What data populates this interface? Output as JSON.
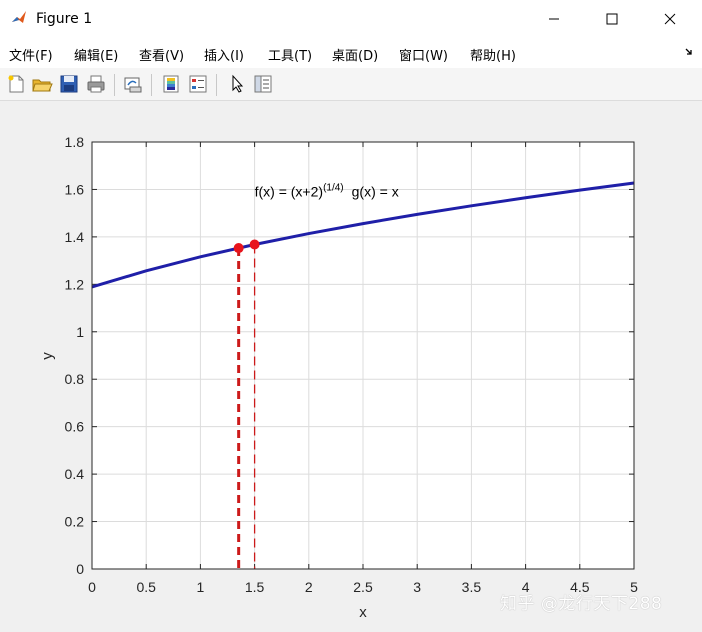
{
  "window": {
    "title": "Figure 1",
    "icon": "matlab-logo-icon",
    "controls": [
      "minimize-icon",
      "maximize-icon",
      "close-icon"
    ]
  },
  "menu": {
    "items": [
      "文件(F)",
      "编辑(E)",
      "查看(V)",
      "插入(I)",
      "工具(T)",
      "桌面(D)",
      "窗口(W)",
      "帮助(H)"
    ],
    "overflow_icon": "dock-arrow-icon"
  },
  "toolbar": {
    "buttons": [
      "new-figure-icon",
      "open-file-icon",
      "save-icon",
      "print-icon",
      "link-plot-icon",
      "insert-colorbar-icon",
      "insert-legend-icon",
      "edit-plot-arrow-icon",
      "property-inspector-icon"
    ]
  },
  "chart_data": {
    "type": "line",
    "xlabel": "x",
    "ylabel": "y",
    "xlim": [
      0,
      5
    ],
    "ylim": [
      0,
      1.8
    ],
    "xticks": [
      "0",
      "0.5",
      "1",
      "1.5",
      "2",
      "2.5",
      "3",
      "3.5",
      "4",
      "4.5",
      "5"
    ],
    "yticks": [
      "0",
      "0.2",
      "0.4",
      "0.6",
      "0.8",
      "1",
      "1.2",
      "1.4",
      "1.6",
      "1.8"
    ],
    "grid": true,
    "annotation": {
      "f_prefix": "f(x) = (x+2)",
      "f_exponent": "(1/4)",
      "g_text": "g(x) = x",
      "x": 1.5,
      "y": 1.57
    },
    "series": [
      {
        "color": "#1f1fa8",
        "x": [
          0,
          0.5,
          1,
          1.5,
          2,
          2.5,
          3,
          3.5,
          4,
          4.5,
          5
        ],
        "y": [
          1.189,
          1.257,
          1.316,
          1.368,
          1.414,
          1.456,
          1.495,
          1.531,
          1.565,
          1.597,
          1.627
        ]
      }
    ],
    "points": [
      {
        "x": 1.353,
        "y": 1.353,
        "color": "#e8141c"
      },
      {
        "x": 1.5,
        "y": 1.368,
        "color": "#e8141c"
      }
    ],
    "drop_lines": [
      {
        "x": 1.353,
        "y": 1.353,
        "style": "thick-dashed",
        "color": "#cc1a1a"
      },
      {
        "x": 1.5,
        "y": 1.368,
        "style": "thin-dashed",
        "color": "#cc1a1a"
      }
    ]
  },
  "watermark": "知乎 @龙行天下288"
}
